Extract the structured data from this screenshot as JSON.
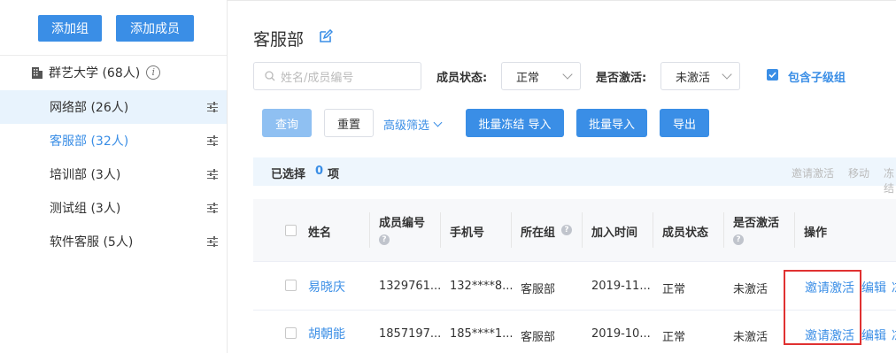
{
  "sidebar": {
    "add_group_label": "添加组",
    "add_member_label": "添加成员",
    "root_label": "群艺大学 (68人)",
    "groups": [
      {
        "label": "网络部 (26人)",
        "state": "hover"
      },
      {
        "label": "客服部 (32人)",
        "state": "selected"
      },
      {
        "label": "培训部 (3人)",
        "state": "normal"
      },
      {
        "label": "测试组 (3人)",
        "state": "normal"
      },
      {
        "label": "软件客服 (5人)",
        "state": "normal"
      }
    ]
  },
  "header": {
    "title": "客服部"
  },
  "filters": {
    "search_placeholder": "姓名/成员编号",
    "status_label": "成员状态:",
    "status_value": "正常",
    "activated_label": "是否激活:",
    "activated_value": "未激活",
    "include_sub_label": "包含子级组",
    "include_sub_checked": true
  },
  "actions": {
    "query": "查询",
    "reset": "重置",
    "advanced": "高级筛选",
    "batch_freeze": "批量冻结 导入",
    "batch_import": "批量导入",
    "export": "导出"
  },
  "selection": {
    "prefix": "已选择",
    "count": "0",
    "suffix": "项",
    "bulk_actions": [
      "邀请激活",
      "移动",
      "冻结"
    ]
  },
  "table": {
    "headers": {
      "name": "姓名",
      "member_id": "成员编号",
      "phone": "手机号",
      "group": "所在组",
      "join_time": "加入时间",
      "status": "成员状态",
      "activated": "是否激活",
      "ops": "操作"
    },
    "rows": [
      {
        "name": "易晓庆",
        "member_id": "1329761...",
        "phone": "132****8...",
        "group": "客服部",
        "join_time": "2019-11...",
        "status": "正常",
        "activated": "未激活",
        "op_invite": "邀请激活",
        "op_edit": "编辑",
        "op_more": "冻"
      },
      {
        "name": "胡朝能",
        "member_id": "1857197...",
        "phone": "185****1...",
        "group": "客服部",
        "join_time": "2019-10...",
        "status": "正常",
        "activated": "未激活",
        "op_invite": "邀请激活",
        "op_edit": "编辑",
        "op_more": "冻"
      }
    ]
  },
  "colors": {
    "primary": "#3a8ee6",
    "highlight": "#e03131",
    "selection_bg": "#eef6fd"
  }
}
